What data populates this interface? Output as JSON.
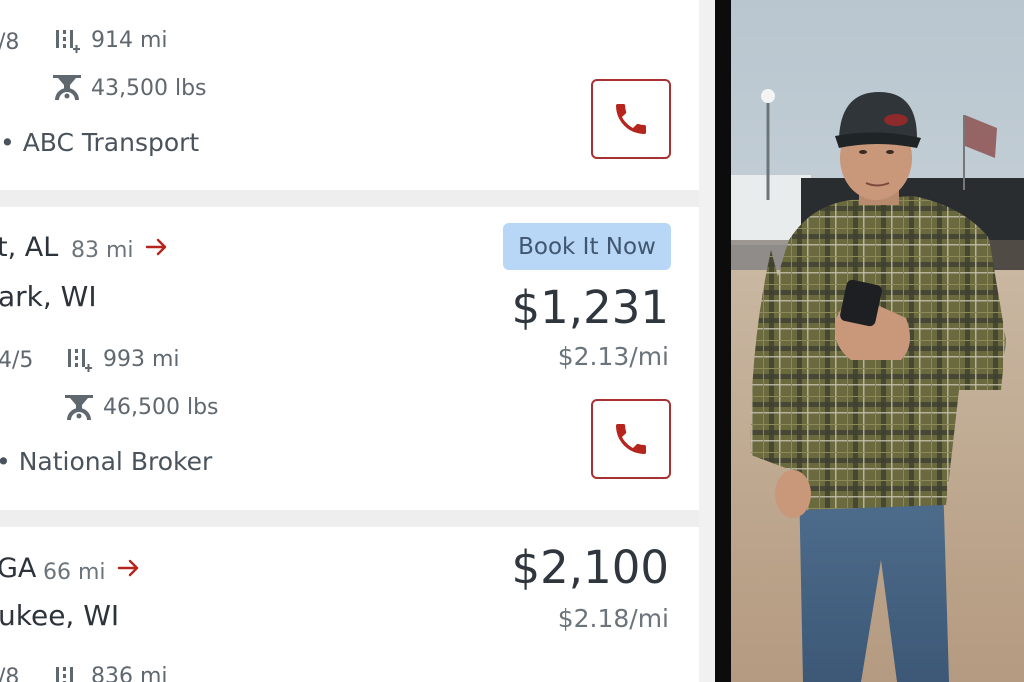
{
  "loads": [
    {
      "dates": "/8",
      "distance": "914 mi",
      "weight": "43,500 lbs",
      "broker": "• ABC Transport"
    },
    {
      "origin": "t, AL",
      "deadhead": "83 mi",
      "destination": "ark, WI",
      "book_label": "Book It Now",
      "price": "$1,231",
      "rate": "$2.13/mi",
      "dates": "4/5",
      "distance": "993 mi",
      "weight": "46,500 lbs",
      "broker": "• National Broker"
    },
    {
      "origin": "GA",
      "deadhead": "66 mi",
      "destination": "ukee, WI",
      "price": "$2,100",
      "rate": "$2.18/mi",
      "dates": "/8",
      "distance": "836 mi"
    }
  ],
  "colors": {
    "accent_red": "#b5251d",
    "book_bg": "#b8d6f5"
  },
  "icons": [
    "distance-icon",
    "weight-icon",
    "phone-icon",
    "arrow-right-icon"
  ]
}
